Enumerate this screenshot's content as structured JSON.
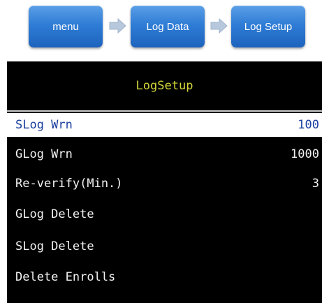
{
  "breadcrumb": {
    "steps": [
      {
        "label": "menu"
      },
      {
        "label": "Log Data"
      },
      {
        "label": "Log Setup"
      }
    ],
    "colors": {
      "step_bg": "#2f7dd6",
      "arrow": "#b7c8dc"
    }
  },
  "screen": {
    "title": "LogSetup",
    "colors": {
      "background": "#000000",
      "title": "#d4d63a",
      "text": "#f2f2f2",
      "selected_bg": "#ffffff",
      "selected_text": "#1a3fa0"
    },
    "items": [
      {
        "label": "SLog Wrn",
        "value": "100",
        "selected": true
      },
      {
        "label": "GLog Wrn",
        "value": "1000",
        "selected": false
      },
      {
        "label": "Re-verify(Min.)",
        "value": "3",
        "selected": false
      },
      {
        "label": "GLog Delete",
        "value": "",
        "selected": false
      },
      {
        "label": "SLog Delete",
        "value": "",
        "selected": false
      },
      {
        "label": "Delete Enrolls",
        "value": "",
        "selected": false
      }
    ]
  }
}
